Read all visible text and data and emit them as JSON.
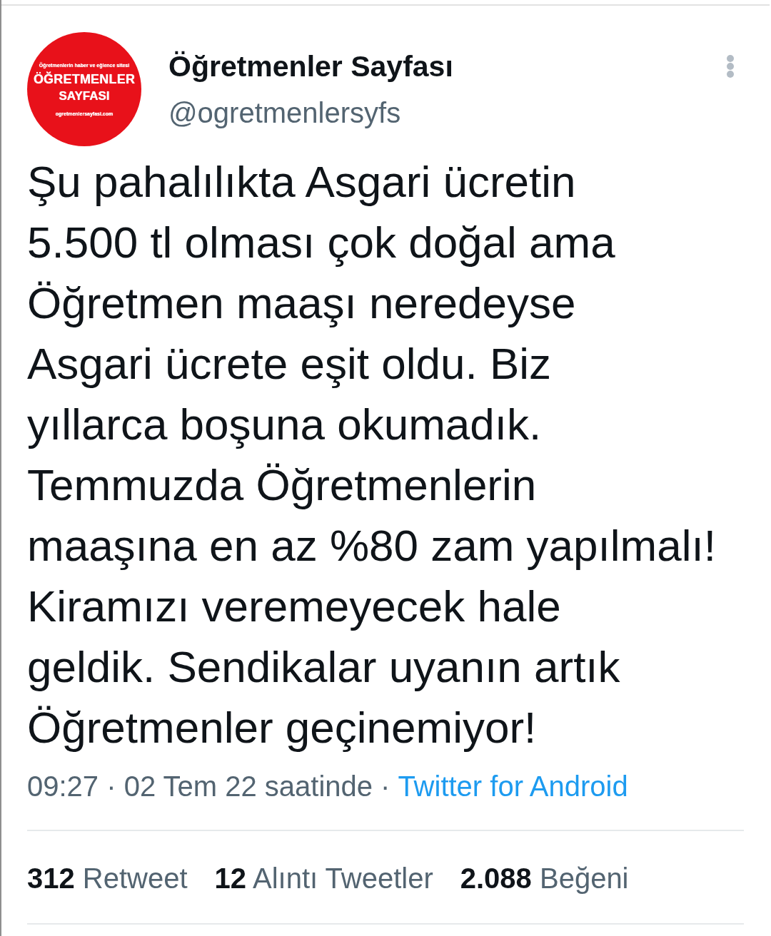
{
  "header": {
    "avatar": {
      "tagline": "Öğretmenlerin haber ve eğlence sitesi",
      "title": "ÖĞRETMENLER",
      "subtitle": "SAYFASI",
      "url": "ogretmenlersayfasi.com"
    },
    "display_name": "Öğretmenler Sayfası",
    "handle": "@ogretmenlersyfs"
  },
  "tweet": {
    "text": "Şu pahalılıkta Asgari ücretin\n5.500 tl olması çok doğal ama\nÖğretmen maaşı neredeyse\nAsgari ücrete eşit oldu. Biz\nyıllarca boşuna okumadık.\nTemmuzda Öğretmenlerin\nmaaşına en az %80 zam yapılmalı!\nKiramızı veremeyecek hale\ngeldik. Sendikalar uyanın artık\nÖğretmenler geçinemiyor!"
  },
  "meta": {
    "timestamp": "09:27 · 02 Tem 22 saatinde",
    "separator": "·",
    "source": "Twitter for Android"
  },
  "stats": [
    {
      "count": "312",
      "label": "Retweet"
    },
    {
      "count": "12",
      "label": "Alıntı Tweetler"
    },
    {
      "count": "2.088",
      "label": "Beğeni"
    }
  ]
}
